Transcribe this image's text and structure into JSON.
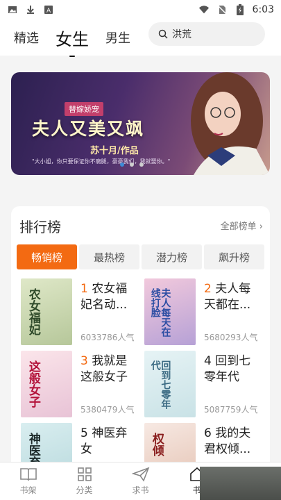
{
  "status": {
    "time": "6:03",
    "icons": [
      "image-icon",
      "download-icon",
      "font-icon",
      "wifi-icon",
      "no-sim-icon",
      "battery-charging-icon"
    ]
  },
  "header": {
    "tabs": [
      "精选",
      "女生",
      "男生"
    ],
    "active_tab": "女生",
    "search_value": "洪荒"
  },
  "banner": {
    "tag": "替嫁娇宠",
    "title": "夫人又美又飒",
    "author": "苏十月/作品",
    "quote": "\"大小姐，你只要保证你不瘸腿，豪豪我们，我就娶你。\"",
    "dots": 3,
    "active_dot": 0
  },
  "ranking": {
    "title": "排行榜",
    "more": "全部榜单",
    "tabs": [
      "畅销榜",
      "最热榜",
      "潜力榜",
      "飙升榜"
    ],
    "active_tab": "畅销榜",
    "books": [
      {
        "rank": "1",
        "title": "农女福妃名动...",
        "popularity": "6033786人气",
        "cover_text": "农女福妃"
      },
      {
        "rank": "2",
        "title": "夫人每天都在...",
        "popularity": "5680293人气",
        "cover_text": "夫人每天在线打脸"
      },
      {
        "rank": "3",
        "title": "我就是这般女子",
        "popularity": "5380479人气",
        "cover_text": "这般女子"
      },
      {
        "rank": "4",
        "title": "回到七零年代",
        "popularity": "5087759人气",
        "cover_text": "回到七零年代"
      },
      {
        "rank": "5",
        "title": "神医弃女",
        "popularity": "",
        "cover_text": "神医弃女"
      },
      {
        "rank": "6",
        "title": "我的夫君权倾...",
        "popularity": "",
        "cover_text": "权倾"
      }
    ]
  },
  "bottom_nav": [
    "书架",
    "分类",
    "求书",
    "书"
  ],
  "colors": {
    "accent": "#f36a12",
    "dot_active": "#3e8bd6"
  }
}
